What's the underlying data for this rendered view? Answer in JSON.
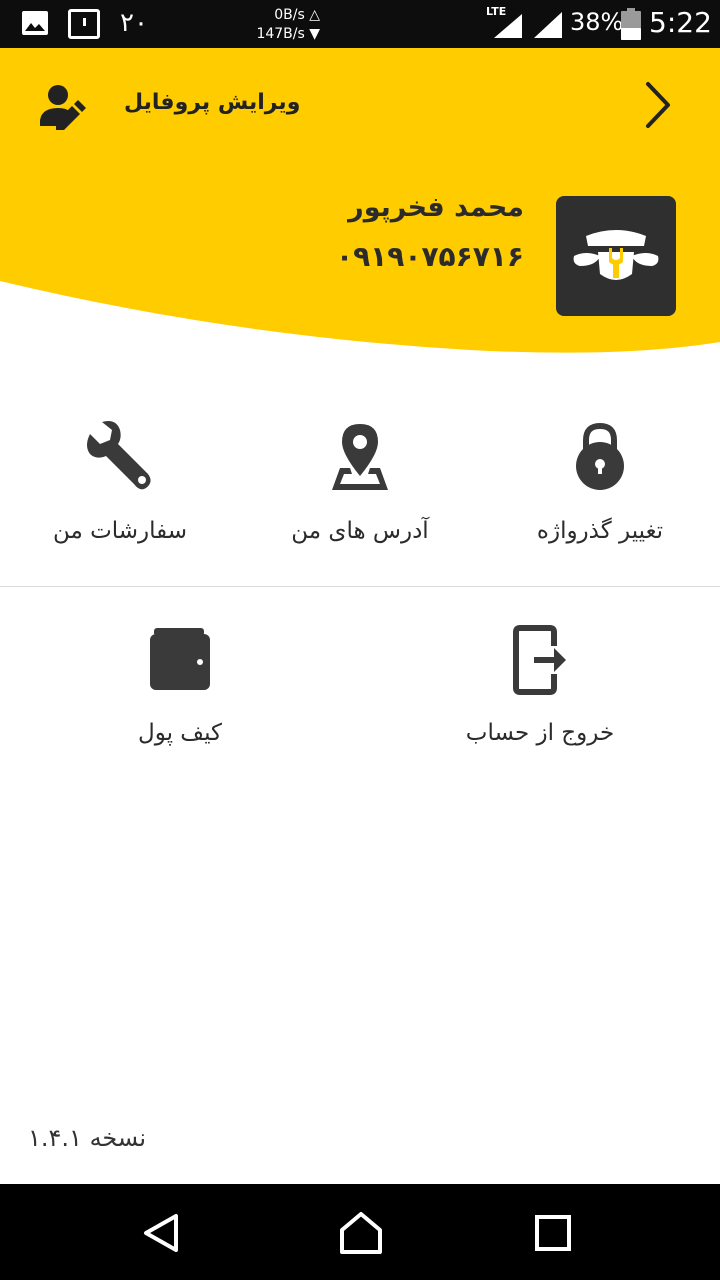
{
  "status_bar": {
    "notification_count": "۲۰",
    "net_up": "0B/s △",
    "net_down": "147B/s ▼",
    "network_type": "LTE",
    "battery": "38%",
    "time": "5:22",
    "icons": [
      "photo-icon",
      "sim-icon",
      "signal-icon",
      "battery-icon"
    ]
  },
  "header": {
    "edit_profile_label": "ویرایش پروفایل",
    "user_name": "محمد فخرپور",
    "user_phone": "۰۹۱۹۰۷۵۶۷۱۶",
    "accent_color": "#FFCC00"
  },
  "menu": {
    "row1": [
      {
        "label": "تغییر گذرواژه",
        "icon": "lock-icon"
      },
      {
        "label": "آدرس های من",
        "icon": "location-pin-icon"
      },
      {
        "label": "سفارشات من",
        "icon": "wrench-icon"
      }
    ],
    "row2": [
      {
        "label": "خروج از حساب",
        "icon": "logout-icon"
      },
      {
        "label": "کیف پول",
        "icon": "wallet-icon"
      }
    ]
  },
  "footer": {
    "version": "نسخه ۱.۴.۱"
  },
  "navbar": {
    "icons": [
      "back-triangle-icon",
      "home-icon",
      "recents-icon"
    ]
  }
}
